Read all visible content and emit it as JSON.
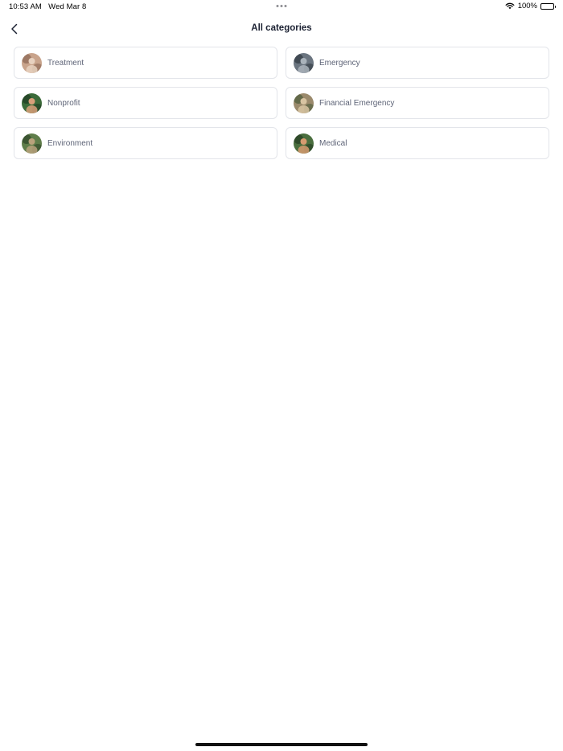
{
  "status_bar": {
    "time": "10:53 AM",
    "date": "Wed Mar 8",
    "battery": "100%",
    "icons": [
      "wifi-icon",
      "battery-icon"
    ]
  },
  "nav": {
    "title": "All categories",
    "back_icon": "chevron-left-icon"
  },
  "categories": [
    {
      "label": "Treatment",
      "avatar": "treatment-avatar",
      "colors": [
        "#c9a48c",
        "#8a6552",
        "#e8d2c0"
      ]
    },
    {
      "label": "Emergency",
      "avatar": "emergency-avatar",
      "colors": [
        "#6b7580",
        "#2f3740",
        "#aab3bb"
      ]
    },
    {
      "label": "Nonprofit",
      "avatar": "nonprofit-avatar",
      "colors": [
        "#3c6b3a",
        "#1e3b22",
        "#d9a07a"
      ]
    },
    {
      "label": "Financial Emergency",
      "avatar": "financial-emergency-avatar",
      "colors": [
        "#9b8a6c",
        "#4b5b3a",
        "#d8c4a2"
      ]
    },
    {
      "label": "Environment",
      "avatar": "environment-avatar",
      "colors": [
        "#5f7d4a",
        "#2e4428",
        "#b9a27c"
      ]
    },
    {
      "label": "Medical",
      "avatar": "medical-avatar",
      "colors": [
        "#4a6e3e",
        "#233a22",
        "#d69b70"
      ]
    }
  ]
}
